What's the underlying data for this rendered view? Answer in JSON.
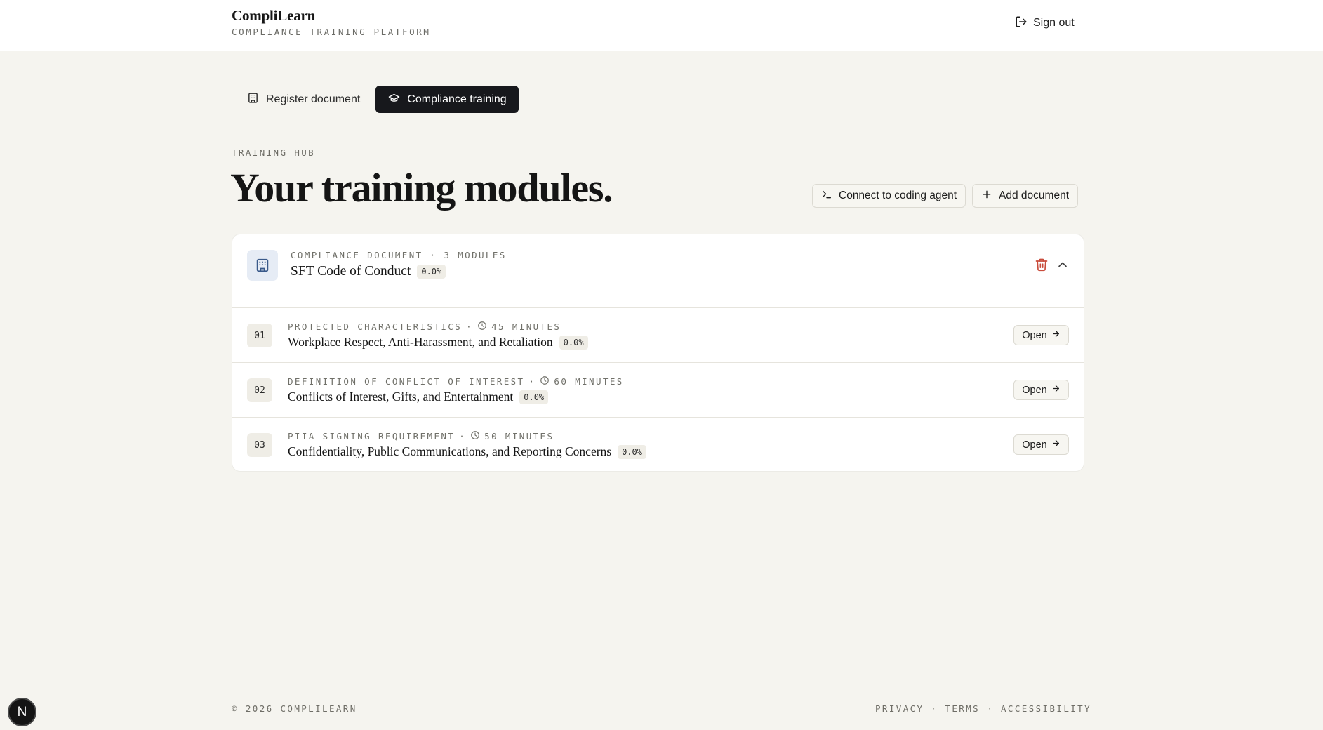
{
  "header": {
    "brand_name": "CompliLearn",
    "brand_tagline": "COMPLIANCE TRAINING PLATFORM",
    "sign_out_label": "Sign out"
  },
  "tabs": [
    {
      "label": "Register document",
      "icon": "building-icon",
      "active": false
    },
    {
      "label": "Compliance training",
      "icon": "graduation-cap-icon",
      "active": true
    }
  ],
  "hub": {
    "eyebrow": "TRAINING HUB",
    "title": "Your training modules.",
    "connect_label": "Connect to coding agent",
    "add_label": "Add document"
  },
  "document": {
    "eyebrow": "COMPLIANCE DOCUMENT · 3 MODULES",
    "title": "SFT Code of Conduct",
    "progress": "0.0%",
    "modules": [
      {
        "number": "01",
        "topic": "PROTECTED CHARACTERISTICS",
        "duration": "45 MINUTES",
        "title": "Workplace Respect, Anti-Harassment, and Retaliation",
        "progress": "0.0%",
        "open_label": "Open"
      },
      {
        "number": "02",
        "topic": "DEFINITION OF CONFLICT OF INTEREST",
        "duration": "60 MINUTES",
        "title": "Conflicts of Interest, Gifts, and Entertainment",
        "progress": "0.0%",
        "open_label": "Open"
      },
      {
        "number": "03",
        "topic": "PIIA SIGNING REQUIREMENT",
        "duration": "50 MINUTES",
        "title": "Confidentiality, Public Communications, and Reporting Concerns",
        "progress": "0.0%",
        "open_label": "Open"
      }
    ]
  },
  "footer": {
    "copyright": "© 2026 COMPLILEARN",
    "privacy": "PRIVACY",
    "terms": "TERMS",
    "accessibility": "ACCESSIBILITY",
    "separator": "·"
  },
  "dev_badge": "N",
  "colors": {
    "background": "#f5f4ef",
    "active_tab": "#17181c",
    "delete": "#c94c3c",
    "doc_icon_bg": "#e6ecf5"
  }
}
